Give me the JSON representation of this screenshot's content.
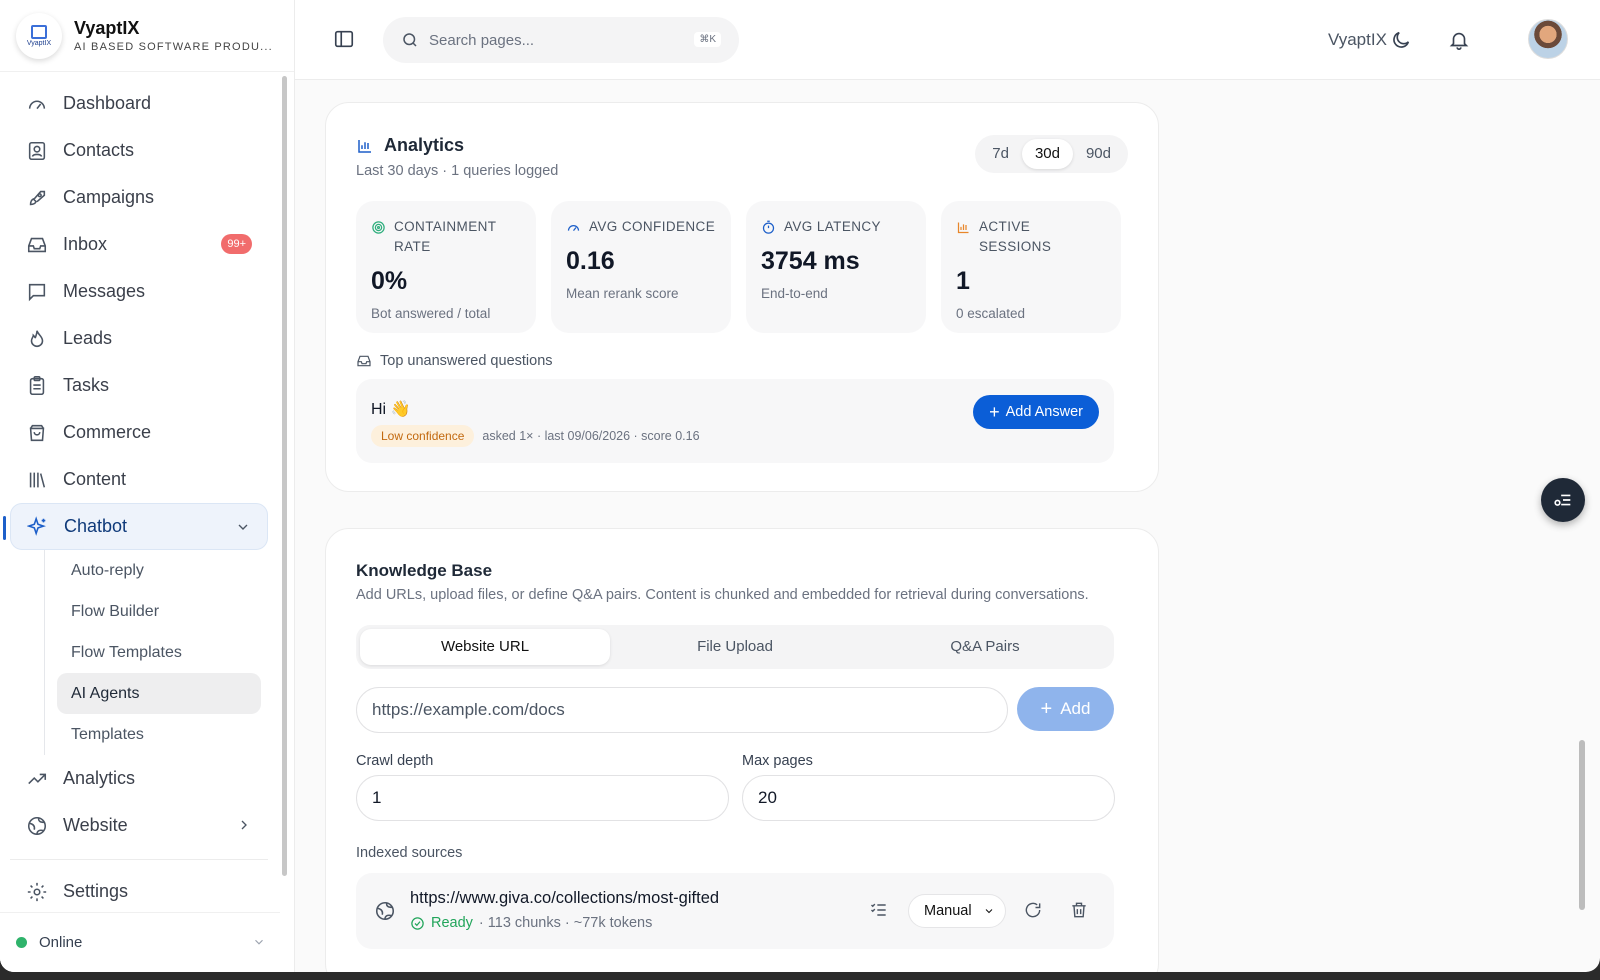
{
  "brand": {
    "name": "VyaptIX",
    "subtitle": "AI BASED SOFTWARE PRODU...",
    "logo_text": "VyaptIX"
  },
  "sidebar": {
    "items": [
      {
        "label": "Dashboard",
        "icon": "gauge-icon"
      },
      {
        "label": "Contacts",
        "icon": "contact-card-icon"
      },
      {
        "label": "Campaigns",
        "icon": "rocket-icon"
      },
      {
        "label": "Inbox",
        "icon": "inbox-icon",
        "badge": "99+"
      },
      {
        "label": "Messages",
        "icon": "message-icon"
      },
      {
        "label": "Leads",
        "icon": "flame-icon"
      },
      {
        "label": "Tasks",
        "icon": "clipboard-icon"
      },
      {
        "label": "Commerce",
        "icon": "shopping-bag-icon"
      },
      {
        "label": "Content",
        "icon": "library-icon"
      },
      {
        "label": "Chatbot",
        "icon": "sparkles-icon"
      }
    ],
    "chatbot_sub": [
      "Auto-reply",
      "Flow Builder",
      "Flow Templates",
      "AI Agents",
      "Templates"
    ],
    "after": [
      {
        "label": "Analytics",
        "icon": "trend-icon"
      },
      {
        "label": "Website",
        "icon": "globe-icon"
      }
    ],
    "settings": "Settings",
    "status": "Online"
  },
  "topbar": {
    "search_placeholder": "Search pages...",
    "shortcut": "⌘K",
    "workspace": "VyaptIX"
  },
  "analytics": {
    "title": "Analytics",
    "subtitle": "Last 30 days · 1 queries logged",
    "ranges": [
      "7d",
      "30d",
      "90d"
    ],
    "selected_range": "30d",
    "stats": [
      {
        "label": "CONTAINMENT RATE",
        "value": "0%",
        "note": "Bot answered / total",
        "color": "#2fae7d"
      },
      {
        "label": "AVG CONFIDENCE",
        "value": "0.16",
        "note": "Mean rerank score",
        "color": "#1d5fc9"
      },
      {
        "label": "AVG LATENCY",
        "value": "3754 ms",
        "note": "End-to-end",
        "color": "#1d5fc9"
      },
      {
        "label": "ACTIVE SESSIONS",
        "value": "1",
        "note": "0 escalated",
        "color": "#e8862a"
      }
    ],
    "unanswered_title": "Top unanswered questions",
    "question": {
      "text": "Hi 👋",
      "tag": "Low confidence",
      "meta": "asked 1× · last 09/06/2026 · score 0.16",
      "action": "Add Answer"
    }
  },
  "kb": {
    "title": "Knowledge Base",
    "subtitle": "Add URLs, upload files, or define Q&A pairs. Content is chunked and embedded for retrieval during conversations.",
    "tabs": [
      "Website URL",
      "File Upload",
      "Q&A Pairs"
    ],
    "url_placeholder": "https://example.com/docs",
    "add_label": "Add",
    "crawl_label": "Crawl depth",
    "crawl_value": "1",
    "max_label": "Max pages",
    "max_value": "20",
    "indexed_label": "Indexed sources",
    "source": {
      "url": "https://www.giva.co/collections/most-gifted",
      "status": "Ready",
      "meta": "· 113 chunks · ~77k tokens",
      "mode": "Manual"
    }
  }
}
